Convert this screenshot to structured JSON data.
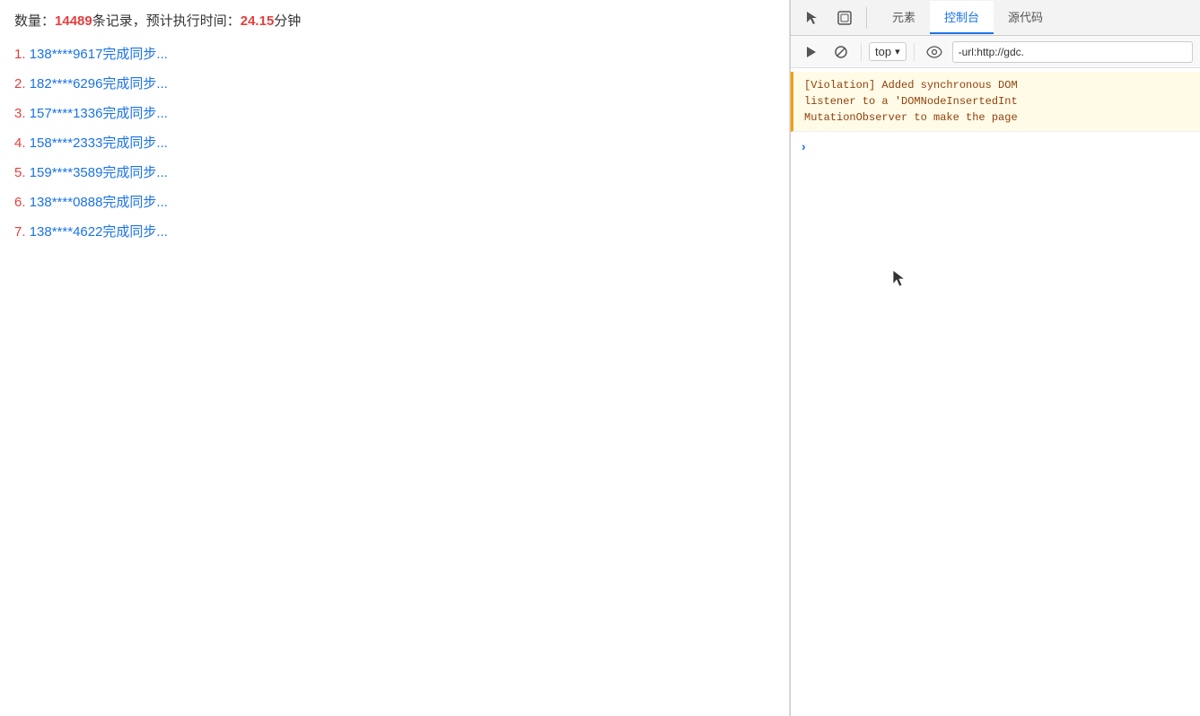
{
  "leftPanel": {
    "statusLine": {
      "prefix": "数量：",
      "count": "14489",
      "unit": "条记录，预计执行时间：",
      "time": "24.15",
      "timeUnit": "分钟"
    },
    "syncItems": [
      {
        "num": "1",
        "text": "138****9617完成同步..."
      },
      {
        "num": "2",
        "text": "182****6296完成同步..."
      },
      {
        "num": "3",
        "text": "157****1336完成同步..."
      },
      {
        "num": "4",
        "text": "158****2333完成同步..."
      },
      {
        "num": "5",
        "text": "159****3589完成同步..."
      },
      {
        "num": "6",
        "text": "138****0888完成同步..."
      },
      {
        "num": "7",
        "text": "138****4622完成同步..."
      }
    ]
  },
  "devtools": {
    "tabs": [
      {
        "id": "elements",
        "label": "元素"
      },
      {
        "id": "console",
        "label": "控制台"
      },
      {
        "id": "sources",
        "label": "源代码"
      }
    ],
    "activeTab": "console",
    "consolebar": {
      "topLabel": "top",
      "filterValue": "-url:http://gdc."
    },
    "consoleMessage": {
      "text": "[Violation] Added synchronous DOM listener to a 'DOMNodeInsertedInt MutationObserver to make the page"
    },
    "chevron": "›"
  },
  "icons": {
    "cursor": "↖",
    "inspect": "⊡",
    "play": "▶",
    "block": "⊘",
    "chevronDown": "▾",
    "eye": "👁",
    "close": "✕",
    "pointer": "⬆"
  }
}
